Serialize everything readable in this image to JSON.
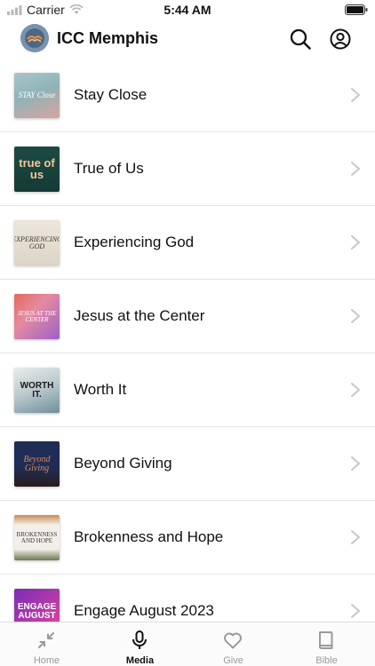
{
  "status_bar": {
    "carrier": "Carrier",
    "time": "5:44 AM"
  },
  "header": {
    "title": "ICC Memphis",
    "logo_icon": "church-logo-icon",
    "search_icon": "search-icon",
    "account_icon": "account-icon"
  },
  "series": [
    {
      "title": "Stay Close",
      "thumb_text": "STAY Close",
      "thumb_colors": [
        "#a9c6c9",
        "#d8a4a0"
      ],
      "text_color": "#ffffff"
    },
    {
      "title": "True of Us",
      "thumb_text": "true of us",
      "thumb_colors": [
        "#1d4b44",
        "#143a36"
      ],
      "text_color": "#f2c79a"
    },
    {
      "title": "Experiencing God",
      "thumb_text": "EXPERIENCING GOD",
      "thumb_colors": [
        "#ece6dc",
        "#ddd4c6"
      ],
      "text_color": "#3a3530"
    },
    {
      "title": "Jesus at the Center",
      "thumb_text": "JESUS AT THE CENTER",
      "thumb_colors": [
        "#e06a5a",
        "#9b62c7"
      ],
      "text_color": "#ffffff"
    },
    {
      "title": "Worth It",
      "thumb_text": "WORTH IT.",
      "thumb_colors": [
        "#e8eceb",
        "#6f8f9b"
      ],
      "text_color": "#1a1a1a"
    },
    {
      "title": "Beyond Giving",
      "thumb_text": "Beyond Giving",
      "thumb_colors": [
        "#1f2c55",
        "#2b1b1a"
      ],
      "text_color": "#d38b5a"
    },
    {
      "title": "Brokenness and Hope",
      "thumb_text": "BROKENNESS AND HOPE",
      "thumb_colors": [
        "#f3efe8",
        "#e7ddd0"
      ],
      "text_color": "#3a3a3a"
    },
    {
      "title": "Engage August 2023",
      "thumb_text": "ENGAGE AUGUST",
      "thumb_colors": [
        "#7a2bb5",
        "#e1459a"
      ],
      "text_color": "#ffffff"
    }
  ],
  "tabs": [
    {
      "label": "Home",
      "icon": "collapse-arrows-icon",
      "active": false
    },
    {
      "label": "Media",
      "icon": "microphone-icon",
      "active": true
    },
    {
      "label": "Give",
      "icon": "heart-icon",
      "active": false
    },
    {
      "label": "Bible",
      "icon": "book-icon",
      "active": false
    }
  ],
  "colors": {
    "divider": "#e5e5e5",
    "chevron": "#c7c7cc",
    "inactive_tab": "#9a9a9a",
    "active_tab": "#111111"
  }
}
